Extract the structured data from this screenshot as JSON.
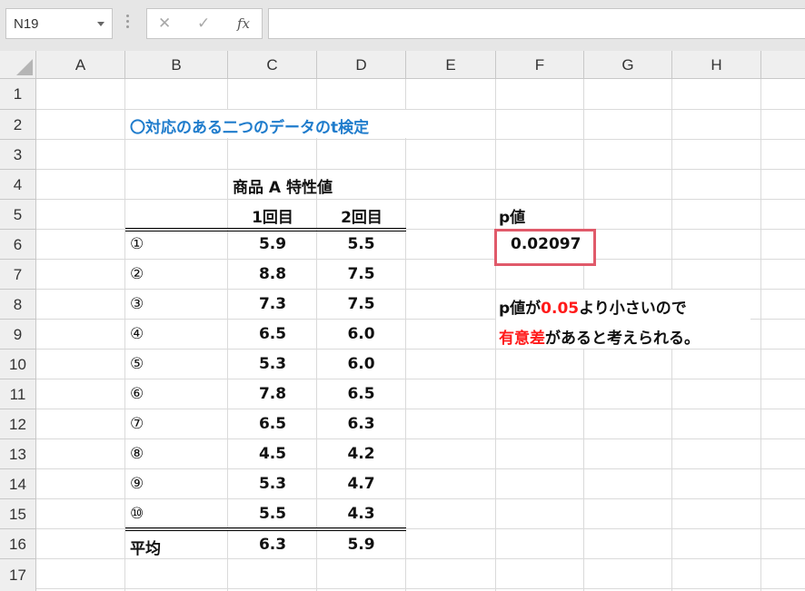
{
  "formula_bar": {
    "name_box": "N19",
    "cancel_icon": "✕",
    "enter_icon": "✓",
    "fx_label": "fx",
    "formula": ""
  },
  "columns": [
    "A",
    "B",
    "C",
    "D",
    "E",
    "F",
    "G",
    "H"
  ],
  "rows": [
    "1",
    "2",
    "3",
    "4",
    "5",
    "6",
    "7",
    "8",
    "9",
    "10",
    "11",
    "12",
    "13",
    "14",
    "15",
    "16",
    "17"
  ],
  "sheet": {
    "title": "〇対応のある二つのデータのt検定",
    "table_header": "商品 A 特性値",
    "col_header_1": "1回目",
    "col_header_2": "2回目",
    "data_rows": [
      {
        "label": "①",
        "v1": "5.9",
        "v2": "5.5"
      },
      {
        "label": "②",
        "v1": "8.8",
        "v2": "7.5"
      },
      {
        "label": "③",
        "v1": "7.3",
        "v2": "7.5"
      },
      {
        "label": "④",
        "v1": "6.5",
        "v2": "6.0"
      },
      {
        "label": "⑤",
        "v1": "5.3",
        "v2": "6.0"
      },
      {
        "label": "⑥",
        "v1": "7.8",
        "v2": "6.5"
      },
      {
        "label": "⑦",
        "v1": "6.5",
        "v2": "6.3"
      },
      {
        "label": "⑧",
        "v1": "4.5",
        "v2": "4.2"
      },
      {
        "label": "⑨",
        "v1": "5.3",
        "v2": "4.7"
      },
      {
        "label": "⑩",
        "v1": "5.5",
        "v2": "4.3"
      }
    ],
    "avg_label": "平均",
    "avg_v1": "6.3",
    "avg_v2": "5.9",
    "p_label": "p値",
    "p_value": "0.02097",
    "note1_prefix": "p値が",
    "note1_highlight": "0.05",
    "note1_suffix": "より小さいので",
    "note2_highlight": "有意差",
    "note2_suffix": "があると考えられる。"
  },
  "colors": {
    "title_blue": "#1f7ccc",
    "highlight_red": "#ff1a1a",
    "pbox_border": "#e05a6a"
  }
}
